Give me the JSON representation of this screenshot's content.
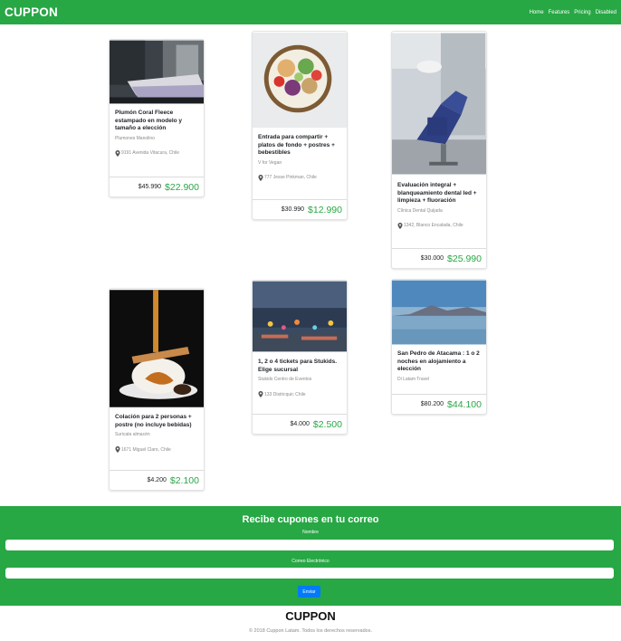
{
  "navbar": {
    "brand": "CUPPON",
    "links": [
      "Home",
      "Features",
      "Pricing",
      "Disabled"
    ]
  },
  "cards": [
    {
      "title": "Plumón Coral Fleece estampado en modelo y tamaño a elección",
      "seller": "Plumones Manolino",
      "address": "9191 Avenida Vitacura, Chile",
      "old_price": "$45.990",
      "new_price": "$22.900",
      "image": "bedroom-photo"
    },
    {
      "title": "Entrada para compartir + platos de fondo + postres + bebestibles",
      "seller": "V for Vegan",
      "address": "777 Jesse Pinkman, Chile",
      "old_price": "$30.990",
      "new_price": "$12.990",
      "image": "salad-bowl-photo"
    },
    {
      "title": "Evaluación integral + blanqueamiento dental led + limpieza + fluoración",
      "seller": "Clínica Dental Quijada",
      "address": "1342, Blanco Encalada, Chile",
      "old_price": "$30.000",
      "new_price": "$25.990",
      "image": "dental-chair-photo"
    },
    {
      "title": "Colación para 2 personas + postre (no incluye bebidas)",
      "seller": "Suricata almacén",
      "address": "1671 Miguel Claro, Chile",
      "old_price": "$4.200",
      "new_price": "$2.100",
      "image": "dessert-photo"
    },
    {
      "title": "1, 2 o 4 tickets para Stukids. Elige sucursal",
      "seller": "Stukids Centro de Eventos",
      "address": "133 Districquic Chile",
      "old_price": "$4.000",
      "new_price": "$2.500",
      "image": "amusement-park-photo"
    },
    {
      "title": "San Pedro de Atacama : 1 o 2 noches en alojamiento a elección",
      "seller": "Di Latam Travel",
      "address": "",
      "old_price": "$80.200",
      "new_price": "$44.100",
      "image": "atacama-lagoon-photo"
    }
  ],
  "subscribe": {
    "heading": "Recibe cupones en tu correo",
    "name_label": "Nombre",
    "email_label": "Correo Electrónico",
    "button": "Enviar"
  },
  "footer": {
    "brand": "CUPPON",
    "copyright": "© 2018 Cuppon Latam. Todos los derechos reservados."
  },
  "colors": {
    "brand_green": "#28a745",
    "button_blue": "#007bff"
  }
}
